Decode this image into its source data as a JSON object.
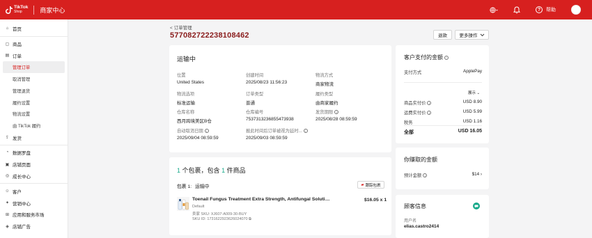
{
  "header": {
    "brand_line1": "TikTok",
    "brand_line2": "Shop",
    "app_title": "商家中心",
    "help_label": "帮助",
    "help_glyph": "?"
  },
  "sidebar": {
    "items": [
      {
        "icon": "home-icon",
        "label": "首页"
      },
      {
        "icon": "product-icon",
        "label": "商品"
      },
      {
        "icon": "order-icon",
        "label": "订单"
      },
      {
        "label": "管理订单",
        "active": true
      },
      {
        "label": "取消管理"
      },
      {
        "label": "管理退货"
      },
      {
        "label": "履约设置"
      },
      {
        "label": "物流设置"
      },
      {
        "label": "由 TikTok 履约"
      },
      {
        "icon": "shipping-icon",
        "label": "发货"
      },
      {
        "icon": "data-icon",
        "label": "数据罗盘"
      },
      {
        "icon": "store-icon",
        "label": "店铺页面"
      },
      {
        "icon": "growth-icon",
        "label": "成长中心"
      },
      {
        "icon": "customer-icon",
        "label": "客户"
      },
      {
        "icon": "marketing-icon",
        "label": "营销中心"
      },
      {
        "icon": "apps-icon",
        "label": "应用和服务市场"
      },
      {
        "icon": "ads-icon",
        "label": "店铺广告"
      }
    ]
  },
  "breadcrumb": "订单管理",
  "breadcrumb_glyph": "<",
  "order_id": "577082722238108462",
  "actions": {
    "return_label": "退款",
    "more_label": "更多操作"
  },
  "status": {
    "title": "运输中",
    "fields": [
      {
        "label": "位置",
        "value": "United States"
      },
      {
        "label": "创建时间",
        "value": "2025/08/23 11:56:23"
      },
      {
        "label": "物流方式",
        "value": "商家物流"
      },
      {
        "label": "物流选项",
        "value": "标准运输"
      },
      {
        "label": "订单类型",
        "value": "普通"
      },
      {
        "label": "履约类型",
        "value": "由商家履约"
      },
      {
        "label": "仓库名称",
        "value": "西月跨境美区B仓"
      },
      {
        "label": "仓库编号",
        "value": "7537313236855473938"
      },
      {
        "label": "发货期限",
        "value": "2025/08/28 08:59:59"
      },
      {
        "label": "自动取消日期",
        "value": "2025/09/04 08:59:59"
      },
      {
        "label": "报此时间后订单被视为延时...",
        "value": "2025/09/03 08:59:59"
      }
    ]
  },
  "package": {
    "count": "1",
    "count_text_1": "个包裹，包含",
    "item_count": "1",
    "count_text_2": "件商品",
    "package_label": "包裹 1:",
    "package_status": "运输中",
    "track_label": "跟踪包裹",
    "product": {
      "name": "Toenail Fungus Treatment Extra Strength, Antifungal Solution for...",
      "price": "$16.05 x 1",
      "variant": "Default",
      "sku": "卖家 SKU: XJ607-A009-30-BUY",
      "sku_id": "SKU ID: 1731622923626024070"
    }
  },
  "payment": {
    "title": "客户支付的金额",
    "method_label": "支付方式",
    "method_value": "ApplePay",
    "expand_label": "展示",
    "rows": [
      {
        "label": "商品实付价",
        "value": "USD 8.90"
      },
      {
        "label": "运费实付价",
        "value": "USD 5.99"
      },
      {
        "label": "税务",
        "value": "USD 1.16"
      }
    ],
    "total_label": "全部",
    "total_value": "USD 16.05"
  },
  "earnings": {
    "title": "你赚取的金额",
    "estimate_label": "预计金额",
    "estimate_value": "$14"
  },
  "customer": {
    "title": "顾客信息",
    "username_label": "用户名",
    "username_value": "elias.castro2414"
  },
  "colors": {
    "brand_red": "#d7201f",
    "teal": "#17a98a",
    "order_title": "#8a1c1c"
  }
}
